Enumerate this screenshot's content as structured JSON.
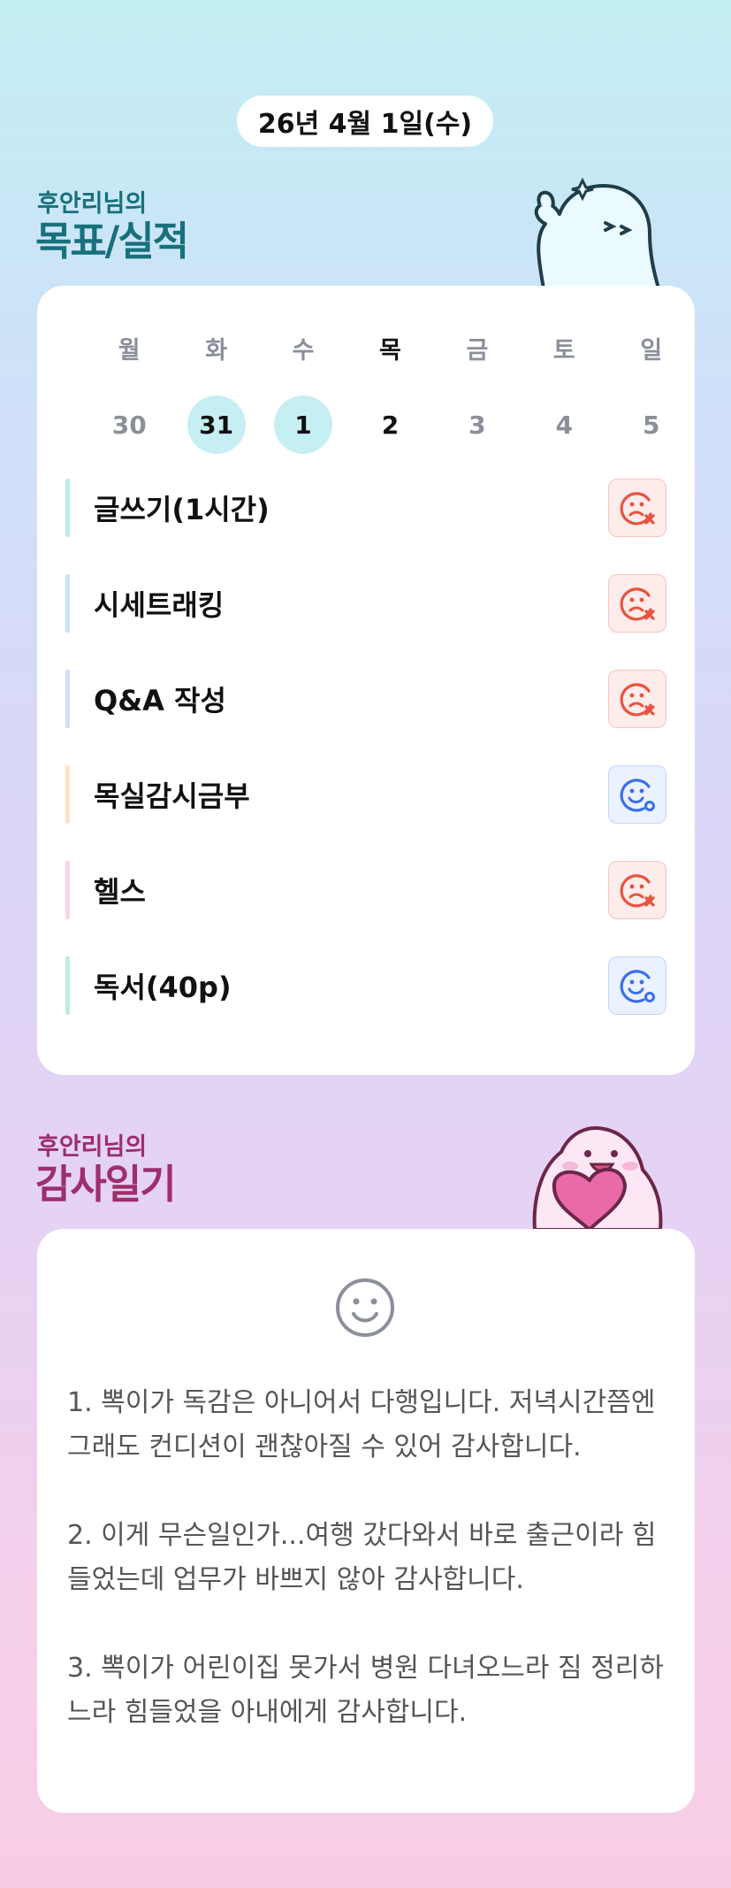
{
  "date_label": "26년 4월 1일(수)",
  "goals_section": {
    "owner": "후안리님의",
    "title": "목표/실적"
  },
  "week": {
    "days": [
      {
        "dow": "월",
        "date": "30",
        "highlight": false,
        "today": false
      },
      {
        "dow": "화",
        "date": "31",
        "highlight": true,
        "today": false
      },
      {
        "dow": "수",
        "date": "1",
        "highlight": true,
        "today": false
      },
      {
        "dow": "목",
        "date": "2",
        "highlight": false,
        "today": true
      },
      {
        "dow": "금",
        "date": "3",
        "highlight": false,
        "today": false
      },
      {
        "dow": "토",
        "date": "4",
        "highlight": false,
        "today": false
      },
      {
        "dow": "일",
        "date": "5",
        "highlight": false,
        "today": false
      }
    ]
  },
  "goals": [
    {
      "name": "글쓰기(1시간)",
      "status": "fail",
      "bar_color": "#bfe8f2",
      "icon": "sad-x-icon"
    },
    {
      "name": "시세트래킹",
      "status": "fail",
      "bar_color": "#c6e4f6",
      "icon": "sad-x-icon"
    },
    {
      "name": "Q&A 작성",
      "status": "fail",
      "bar_color": "#d6dcf5",
      "icon": "sad-x-icon"
    },
    {
      "name": "목실감시금부",
      "status": "ok",
      "bar_color": "#fde3c4",
      "icon": "smile-o-icon"
    },
    {
      "name": "헬스",
      "status": "fail",
      "bar_color": "#fad2e8",
      "icon": "sad-x-icon"
    },
    {
      "name": "독서(40p)",
      "status": "ok",
      "bar_color": "#bdeedd",
      "icon": "smile-o-icon"
    }
  ],
  "diary_section": {
    "owner": "후안리님의",
    "title": "감사일기"
  },
  "diary": {
    "entries": [
      "1. 뽁이가 독감은 아니어서 다행입니다. 저녁시간쯤엔 그래도 컨디션이 괜찮아질 수 있어 감사합니다.",
      "2. 이게 무슨일인가...여행 갔다와서 바로 출근이라 힘들었는데 업무가 바쁘지 않아 감사합니다.",
      "3. 뽁이가 어린이집 못가서 병원 다녀오느라 짐 정리하느라 힘들었을 아내에게 감사합니다."
    ]
  },
  "colors": {
    "goal_title": "#17707c",
    "diary_title": "#9c2f6b",
    "fail": "#e8533f",
    "ok": "#3b6ee8",
    "highlight": "#c6eff4"
  }
}
